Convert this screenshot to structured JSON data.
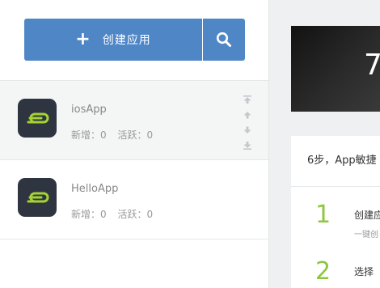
{
  "sidebar": {
    "create_label": "创建应用",
    "apps": [
      {
        "name": "iosApp",
        "new_label": "新增：",
        "new_count": "0",
        "active_label": "活跃：",
        "active_count": "0"
      },
      {
        "name": "HelloApp",
        "new_label": "新增：",
        "new_count": "0",
        "active_label": "活跃：",
        "active_count": "0"
      }
    ]
  },
  "banner": {
    "text": "7"
  },
  "panel": {
    "title": "6步，App敏捷",
    "steps": [
      {
        "num": "1",
        "title": "创建应",
        "desc": "一键创"
      },
      {
        "num": "2",
        "title": "选择"
      }
    ]
  },
  "colors": {
    "primary": "#4f86c6",
    "accent_green": "#8dc63f",
    "icon_bg": "#2f3540"
  }
}
